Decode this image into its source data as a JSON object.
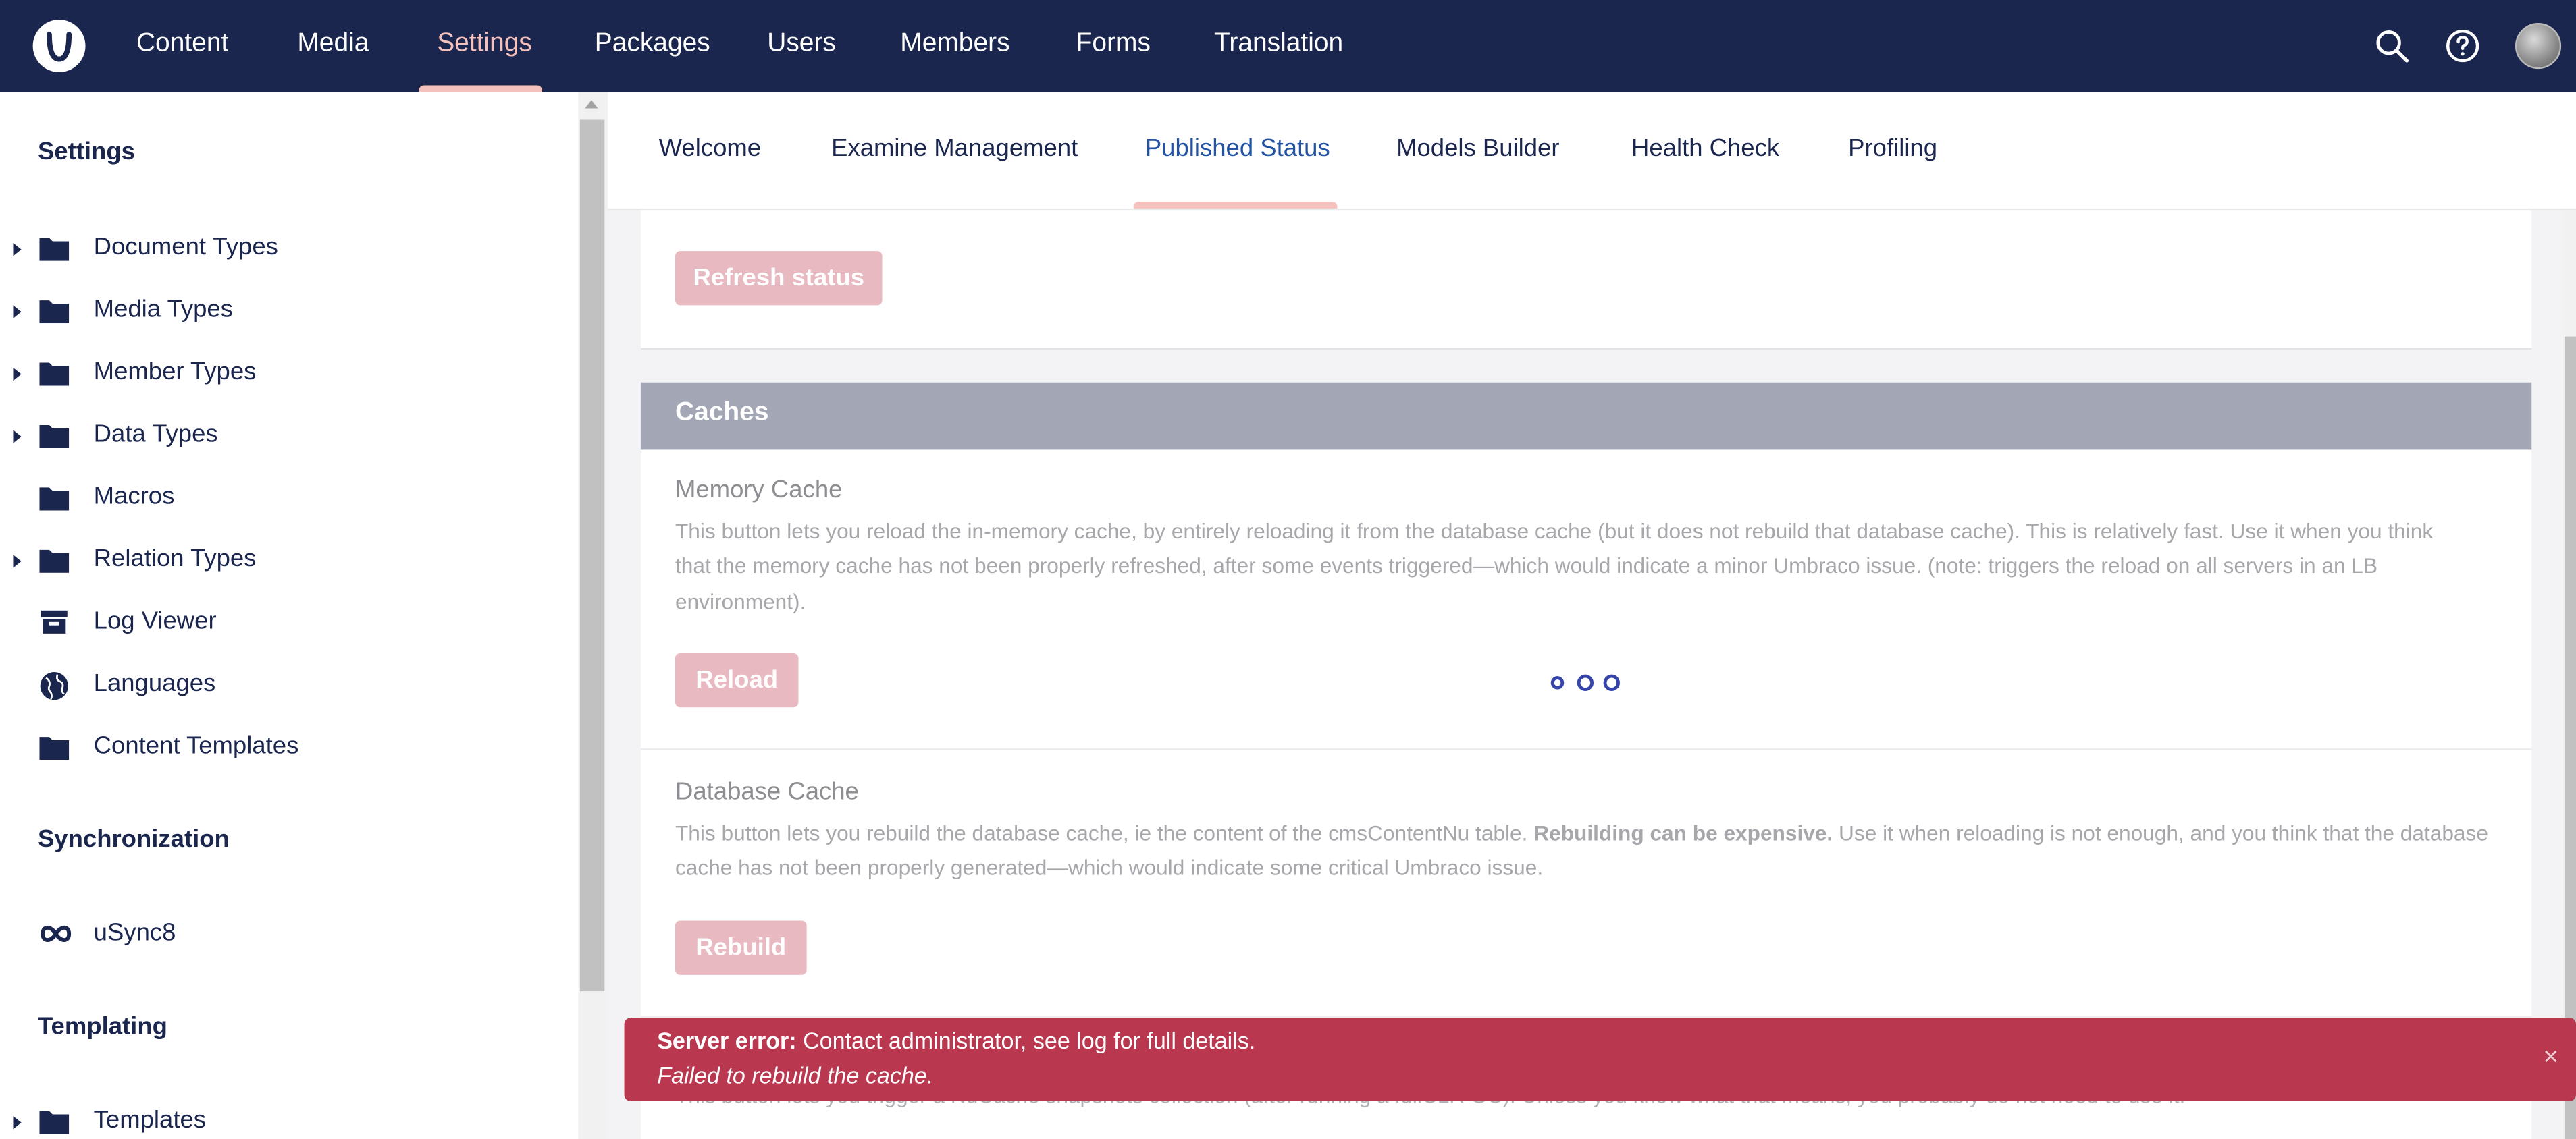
{
  "topnav": {
    "items": [
      "Content",
      "Media",
      "Settings",
      "Packages",
      "Users",
      "Members",
      "Forms",
      "Translation"
    ],
    "active": "Settings"
  },
  "sidebar": {
    "settings_title": "Settings",
    "settings_items": [
      "Document Types",
      "Media Types",
      "Member Types",
      "Data Types",
      "Macros",
      "Relation Types",
      "Log Viewer",
      "Languages",
      "Content Templates"
    ],
    "sync_title": "Synchronization",
    "sync_items": [
      "uSync8"
    ],
    "templating_title": "Templating",
    "templating_items": [
      "Templates"
    ]
  },
  "tabs": [
    "Welcome",
    "Examine Management",
    "Published Status",
    "Models Builder",
    "Health Check",
    "Profiling"
  ],
  "active_tab": "Published Status",
  "published_status": {
    "refresh_button": "Refresh status"
  },
  "caches": {
    "title": "Caches",
    "memory": {
      "title": "Memory Cache",
      "text_1": "This button lets you reload the in-memory cache, by entirely reloading it from the database cache (but it does not rebuild that database cache). This is relatively fast. Use it when you think",
      "text_2": "that the memory cache has not been properly refreshed, after some events triggered—which would indicate a minor Umbraco issue. (note: triggers the reload on all servers in an LB",
      "text_3": "environment).",
      "button": "Reload"
    },
    "database": {
      "title": "Database Cache",
      "text_1a": "This button lets you rebuild the database cache, ie the content of the cmsContentNu table.",
      "text_1b": "Rebuilding can be expensive.",
      "text_1c": "Use it when reloading is not enough, and you think that the database",
      "text_2": "cache has not been properly generated—which would indicate some critical Umbraco issue.",
      "button": "Rebuild"
    },
    "partial_text": "This button lets you trigger a NuCache snapshots collection (after running a fullCLR GC). Unless you know what that means, you probably do not need to use it."
  },
  "toast": {
    "label": "Server error:",
    "message": "Contact administrator, see log for full details.",
    "detail": "Failed to rebuild the cache.",
    "close": "×"
  },
  "icons": {
    "logo": "umbraco-logo-icon",
    "search": "search-icon",
    "help": "help-icon",
    "folder": "folder-icon",
    "archive": "archive-box-icon",
    "globe": "globe-icon",
    "infinity": "infinity-icon"
  },
  "colors": {
    "topbar": "#1b264f",
    "accent": "#f5c1bc",
    "button_disabled": "#e9b9c1",
    "error": "#b9374f",
    "caches_header": "#a3a7b5"
  }
}
